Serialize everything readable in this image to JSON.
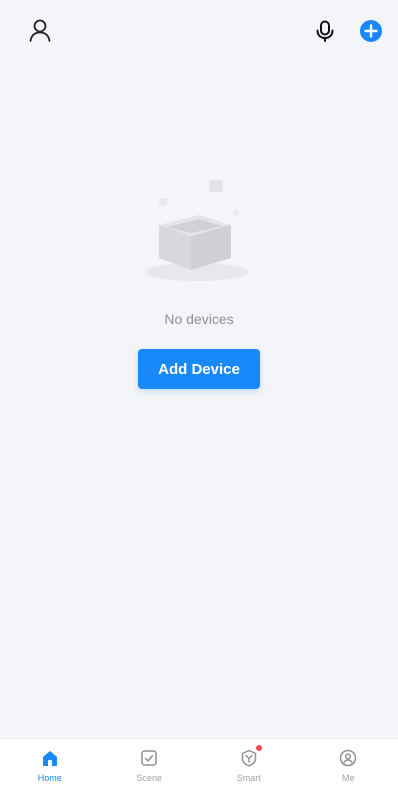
{
  "header": {
    "profile_icon": "person-outline-icon",
    "mic_icon": "microphone-icon",
    "add_icon": "plus-circle-icon",
    "accent_color": "#1989fa"
  },
  "empty_state": {
    "illustration": "empty-box-illustration",
    "message": "No devices",
    "add_device_label": "Add Device"
  },
  "bottom_nav": {
    "items": [
      {
        "label": "Home",
        "icon": "home-icon",
        "active": true
      },
      {
        "label": "Scene",
        "icon": "scene-checkbox-icon",
        "active": false
      },
      {
        "label": "Smart",
        "icon": "smart-shield-icon",
        "active": false,
        "badge": true
      },
      {
        "label": "Me",
        "icon": "me-profile-icon",
        "active": false
      }
    ],
    "active_color": "#1989fa",
    "inactive_color": "#a0a3aa",
    "badge_color": "#f04b4b"
  }
}
